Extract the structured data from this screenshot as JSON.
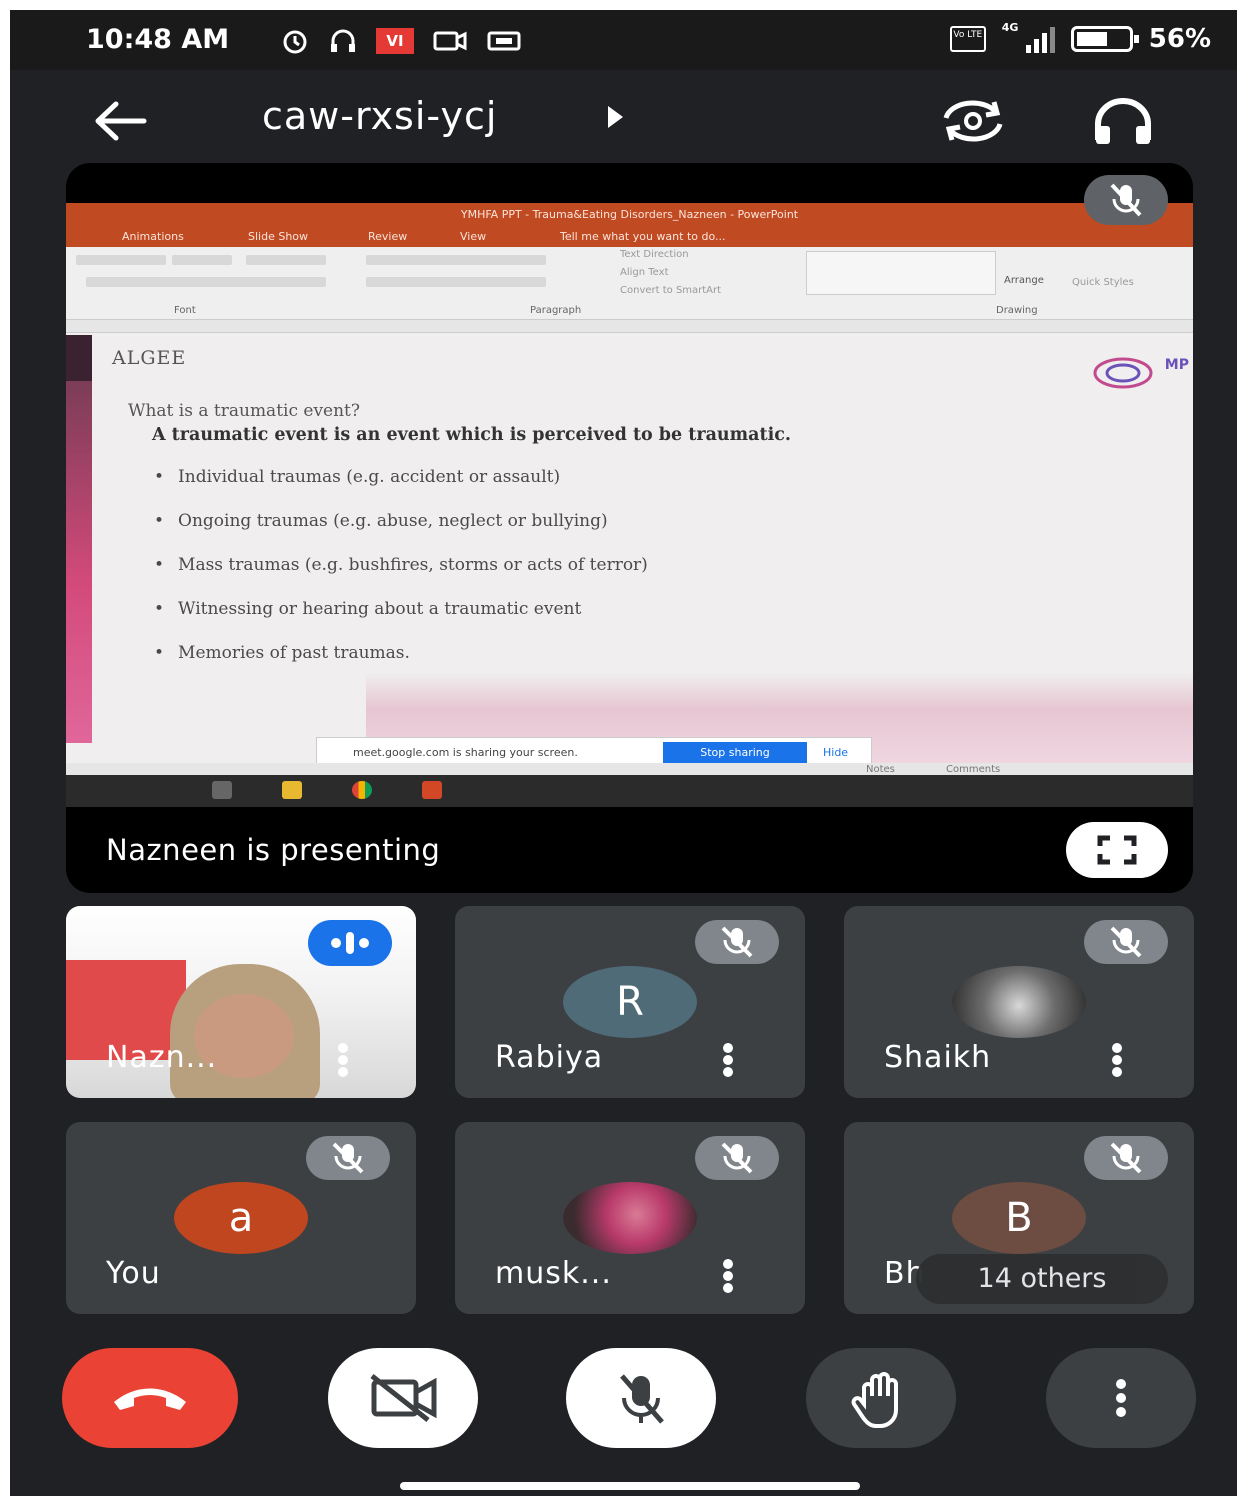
{
  "status_bar": {
    "time": "10:48 AM",
    "network": "4G",
    "volte": "Vo LTE",
    "carrier_badge": "VI",
    "battery": "56%"
  },
  "top_bar": {
    "meeting_code": "caw-rxsi-ycj"
  },
  "presentation": {
    "window_title": "YMHFA PPT - Trauma&Eating Disorders_Nazneen - PowerPoint",
    "ribbon_tabs": [
      "Animations",
      "Slide Show",
      "Review",
      "View",
      "Tell me what you want to do..."
    ],
    "ribbon_groups": [
      "Font",
      "Paragraph",
      "Drawing"
    ],
    "ribbon_items": [
      "Text Direction",
      "Align Text",
      "Convert to SmartArt",
      "Arrange",
      "Quick Styles"
    ],
    "slide": {
      "heading": "ALGEE",
      "question": "What is a traumatic event?",
      "lead": "A traumatic event is an event which is perceived to be traumatic.",
      "bullets": [
        "Individual traumas (e.g. accident or assault)",
        "Ongoing traumas (e.g. abuse, neglect or bullying)",
        "Mass traumas (e.g. bushfires, storms or acts of terror)",
        "Witnessing or hearing about a traumatic event",
        "Memories of past traumas."
      ],
      "logo_text": "MP"
    },
    "share_banner": {
      "message": "meet.google.com is sharing your screen.",
      "stop_label": "Stop sharing",
      "hide_label": "Hide"
    },
    "status_items": [
      "Notes",
      "Comments"
    ],
    "presenting_label": "Nazneen is presenting"
  },
  "participants": [
    {
      "name": "Nazn...",
      "kind": "video",
      "speaking": true
    },
    {
      "name": "Rabiya",
      "kind": "initial",
      "initial": "R",
      "color": "#4f6b78",
      "muted": true
    },
    {
      "name": "Shaikh",
      "kind": "photo",
      "muted": true
    },
    {
      "name": "You",
      "kind": "initial",
      "initial": "a",
      "color": "#c0461f",
      "muted": true
    },
    {
      "name": "musk...",
      "kind": "photo",
      "muted": true
    },
    {
      "name": "Bh",
      "kind": "initial",
      "initial": "B",
      "color": "#6d4c41",
      "muted": true
    }
  ],
  "others_label": "14 others",
  "colors": {
    "background": "#202124",
    "tile": "#3c4043",
    "end_call": "#ea4335",
    "accent": "#1a73e8"
  },
  "icons": [
    "back-arrow-icon",
    "chevron-right-icon",
    "switch-camera-icon",
    "headphones-icon",
    "mic-off-icon",
    "fullscreen-icon",
    "more-vert-icon",
    "end-call-icon",
    "video-off-icon",
    "raise-hand-icon"
  ]
}
